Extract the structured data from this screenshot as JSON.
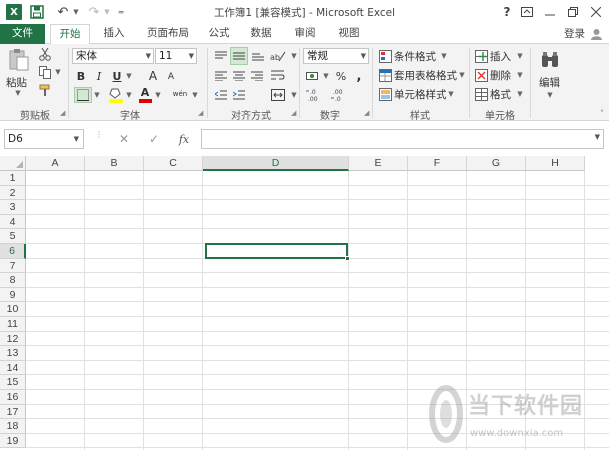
{
  "window": {
    "title": "工作簿1 [兼容模式] - Microsoft Excel",
    "help": "?",
    "app_logo": "X"
  },
  "icons": {
    "excel_logo": "excel-icon",
    "save": "floppy-disk-icon",
    "undo": "undo-icon",
    "redo": "redo-icon",
    "paste": "clipboard-icon",
    "cut": "scissors-icon",
    "copy": "copy-icon",
    "format_painter": "brush-icon",
    "find": "binoculars-icon"
  },
  "colors": {
    "accent": "#217346",
    "font_color_bar": "#e00000",
    "highlight_bar": "#ffff00",
    "ribbon_bg": "#f3f3f3",
    "gridline": "#e1e1e1"
  },
  "tabs": {
    "file": "文件",
    "home": "开始",
    "insert": "插入",
    "page_layout": "页面布局",
    "formulas": "公式",
    "data": "数据",
    "review": "审阅",
    "view": "视图",
    "login": "登录"
  },
  "ribbon": {
    "clipboard": {
      "label": "剪贴板",
      "paste": "粘贴"
    },
    "font": {
      "label": "字体",
      "font_name": "宋体",
      "font_size": "11",
      "bold": "B",
      "italic": "I",
      "underline": "U",
      "grow": "A",
      "shrink": "A",
      "font_color_letter": "A",
      "phonetic": "wén"
    },
    "alignment": {
      "label": "对齐方式"
    },
    "number": {
      "label": "数字",
      "format": "常规",
      "percent": "%",
      "comma": ","
    },
    "styles": {
      "label": "样式",
      "conditional": "条件格式",
      "table": "套用表格格式",
      "cell_styles": "单元格样式"
    },
    "cells": {
      "label": "单元格",
      "insert": "插入",
      "delete": "删除",
      "format": "格式"
    },
    "editing": {
      "label": "编辑"
    }
  },
  "formula_bar": {
    "name_box": "D6",
    "fx": "fx",
    "cancel": "✕",
    "enter": "✓",
    "content": ""
  },
  "grid": {
    "columns": [
      "A",
      "B",
      "C",
      "D",
      "E",
      "F",
      "G",
      "H"
    ],
    "rows": [
      "1",
      "2",
      "3",
      "4",
      "5",
      "6",
      "7",
      "8",
      "9",
      "10",
      "11",
      "12",
      "13",
      "14",
      "15",
      "16",
      "17",
      "18",
      "19"
    ],
    "selected_column": "D",
    "selected_row": "6"
  },
  "watermark": {
    "text": "当下软件园",
    "url": "www.downxia.com"
  }
}
